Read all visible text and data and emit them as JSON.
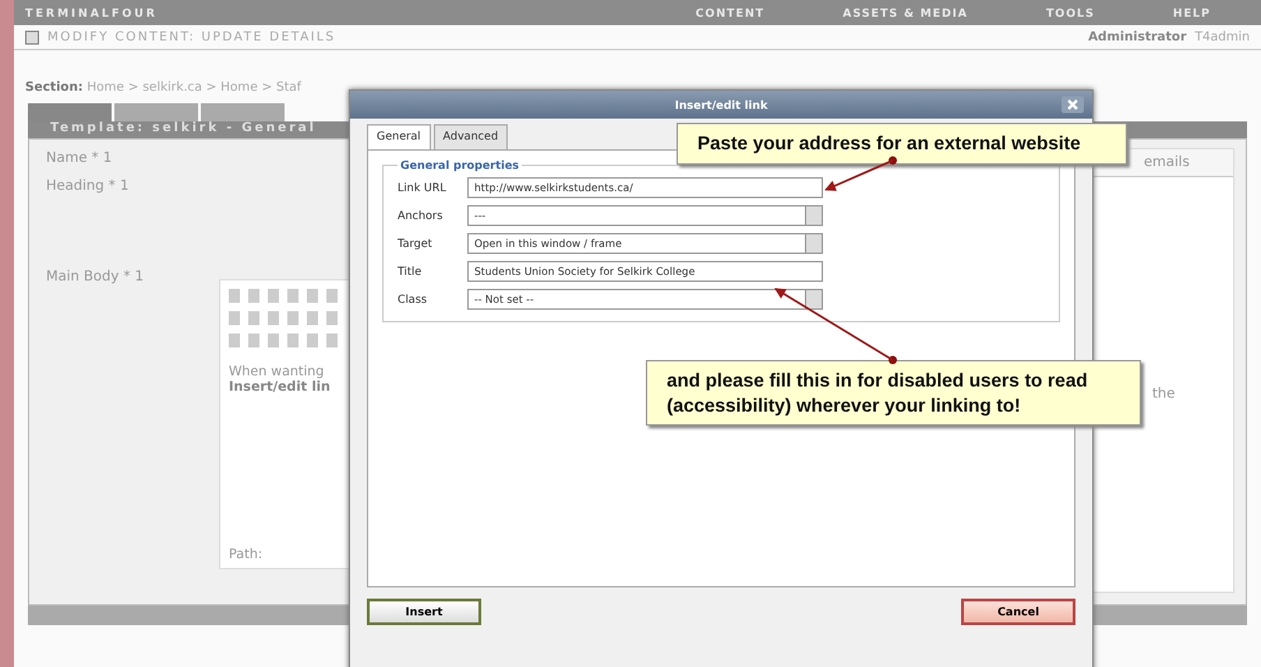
{
  "app": {
    "brand": "TERMINALFOUR",
    "nav": [
      "CONTENT",
      "ASSETS & MEDIA",
      "TOOLS",
      "HELP"
    ],
    "page_title": "MODIFY CONTENT: UPDATE DETAILS",
    "user": "Administrator",
    "user_name": "T4admin"
  },
  "section": {
    "label": "Section:",
    "path": "Home > selkirk.ca > Home > Staf"
  },
  "content_tabs": [
    {
      "selected": true
    },
    {
      "selected": false
    },
    {
      "selected": false
    }
  ],
  "template_bar": "Template: selkirk - General",
  "form_fields": [
    {
      "label": "Name * 1"
    },
    {
      "label": "Heading * 1"
    },
    {
      "label": "Main Body * 1"
    }
  ],
  "editor": {
    "text": "When wanting",
    "bold_text": "Insert/edit lin",
    "path": "Path:"
  },
  "side_panel": {
    "heading": "emails",
    "text": "the"
  },
  "dialog": {
    "title": "Insert/edit link",
    "tabs": [
      {
        "label": "General",
        "selected": true
      },
      {
        "label": "Advanced",
        "selected": false
      }
    ],
    "legend": "General properties",
    "fields": [
      {
        "label": "Link URL",
        "kind": "text",
        "value": "http://www.selkirkstudents.ca/"
      },
      {
        "label": "Anchors",
        "kind": "select",
        "value": "---"
      },
      {
        "label": "Target",
        "kind": "select",
        "value": "Open in this window / frame"
      },
      {
        "label": "Title",
        "kind": "text",
        "value": "Students Union Society for Selkirk College"
      },
      {
        "label": "Class",
        "kind": "select",
        "value": "-- Not set --"
      }
    ],
    "buttons": [
      {
        "label": "Insert",
        "kind": "primary"
      },
      {
        "label": "Cancel",
        "kind": "cancel"
      }
    ]
  },
  "callouts": [
    {
      "text": "Paste your address for an external website"
    },
    {
      "text": "and please fill this in for disabled users to read (accessibility) wherever your linking to!"
    }
  ]
}
